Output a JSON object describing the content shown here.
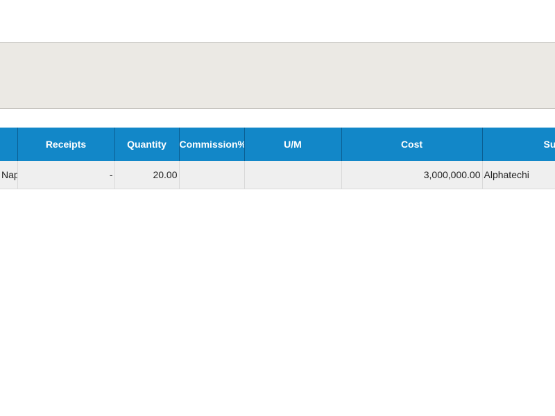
{
  "table": {
    "headers": {
      "col0": "",
      "receipts": "Receipts",
      "quantity": "Quantity",
      "commission": "Commission%",
      "um": "U/M",
      "cost": "Cost",
      "supplier": "Su"
    },
    "rows": [
      {
        "col0": "Nap",
        "receipts": "-",
        "quantity": "20.00",
        "commission": "",
        "um": "",
        "cost": "3,000,000.00",
        "supplier": "Alphatechi"
      }
    ]
  },
  "colors": {
    "header_bg": "#1287c8",
    "row_bg": "#efefef",
    "panel_bg": "#ebe9e4"
  }
}
